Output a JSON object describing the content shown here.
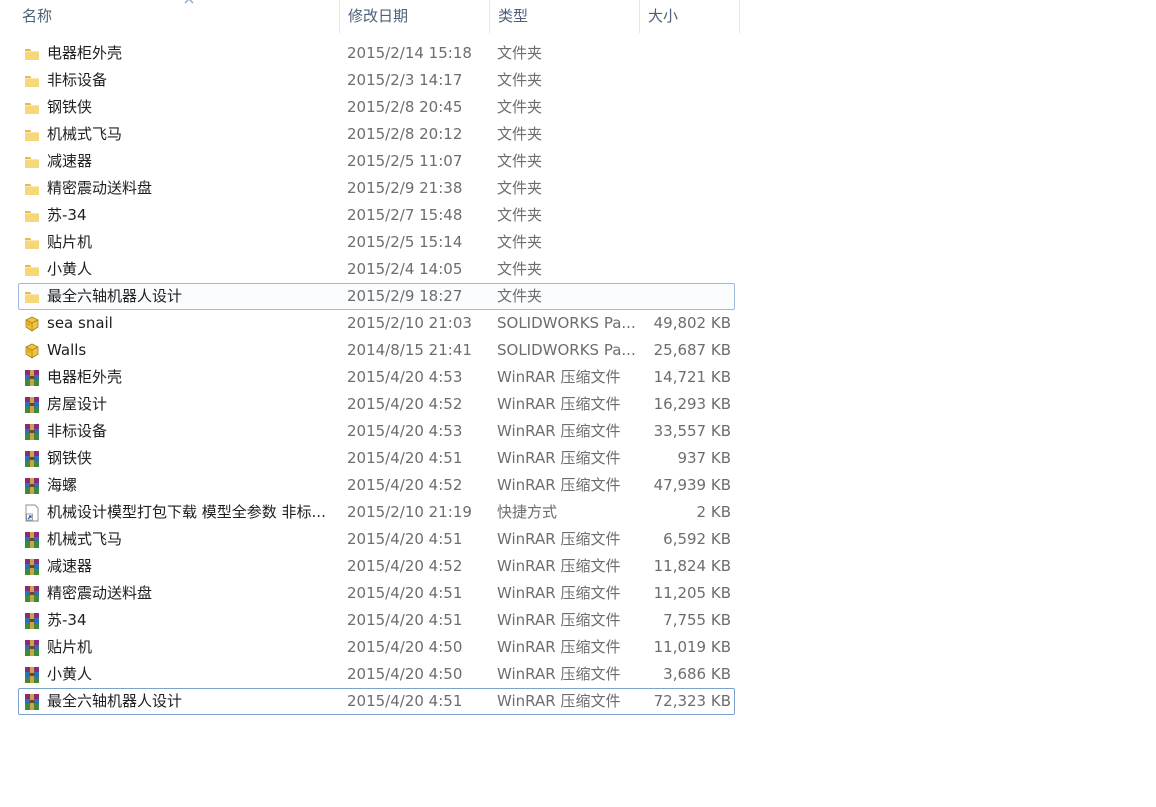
{
  "columns": {
    "name": "名称",
    "date": "修改日期",
    "type": "类型",
    "size": "大小"
  },
  "files": [
    {
      "name": "电器柜外壳",
      "date": "2015/2/14 15:18",
      "type": "文件夹",
      "size": "",
      "icon": "folder-icon"
    },
    {
      "name": "非标设备",
      "date": "2015/2/3 14:17",
      "type": "文件夹",
      "size": "",
      "icon": "folder-icon"
    },
    {
      "name": "钢铁侠",
      "date": "2015/2/8 20:45",
      "type": "文件夹",
      "size": "",
      "icon": "folder-icon"
    },
    {
      "name": "机械式飞马",
      "date": "2015/2/8 20:12",
      "type": "文件夹",
      "size": "",
      "icon": "folder-icon"
    },
    {
      "name": "减速器",
      "date": "2015/2/5 11:07",
      "type": "文件夹",
      "size": "",
      "icon": "folder-icon"
    },
    {
      "name": "精密震动送料盘",
      "date": "2015/2/9 21:38",
      "type": "文件夹",
      "size": "",
      "icon": "folder-icon"
    },
    {
      "name": "苏-34",
      "date": "2015/2/7 15:48",
      "type": "文件夹",
      "size": "",
      "icon": "folder-icon"
    },
    {
      "name": "贴片机",
      "date": "2015/2/5 15:14",
      "type": "文件夹",
      "size": "",
      "icon": "folder-icon"
    },
    {
      "name": "小黄人",
      "date": "2015/2/4 14:05",
      "type": "文件夹",
      "size": "",
      "icon": "folder-icon"
    },
    {
      "name": "最全六轴机器人设计",
      "date": "2015/2/9 18:27",
      "type": "文件夹",
      "size": "",
      "icon": "folder-icon"
    },
    {
      "name": "sea snail",
      "date": "2015/2/10 21:03",
      "type": "SOLIDWORKS Pa...",
      "size": "49,802 KB",
      "icon": "solidworks-icon"
    },
    {
      "name": "Walls",
      "date": "2014/8/15 21:41",
      "type": "SOLIDWORKS Pa...",
      "size": "25,687 KB",
      "icon": "solidworks-icon"
    },
    {
      "name": "电器柜外壳",
      "date": "2015/4/20 4:53",
      "type": "WinRAR 压缩文件",
      "size": "14,721 KB",
      "icon": "winrar-icon"
    },
    {
      "name": "房屋设计",
      "date": "2015/4/20 4:52",
      "type": "WinRAR 压缩文件",
      "size": "16,293 KB",
      "icon": "winrar-icon"
    },
    {
      "name": "非标设备",
      "date": "2015/4/20 4:53",
      "type": "WinRAR 压缩文件",
      "size": "33,557 KB",
      "icon": "winrar-icon"
    },
    {
      "name": "钢铁侠",
      "date": "2015/4/20 4:51",
      "type": "WinRAR 压缩文件",
      "size": "937 KB",
      "icon": "winrar-icon"
    },
    {
      "name": "海螺",
      "date": "2015/4/20 4:52",
      "type": "WinRAR 压缩文件",
      "size": "47,939 KB",
      "icon": "winrar-icon"
    },
    {
      "name": "机械设计模型打包下载 模型全参数 非标...",
      "date": "2015/2/10 21:19",
      "type": "快捷方式",
      "size": "2 KB",
      "icon": "shortcut-icon"
    },
    {
      "name": "机械式飞马",
      "date": "2015/4/20 4:51",
      "type": "WinRAR 压缩文件",
      "size": "6,592 KB",
      "icon": "winrar-icon"
    },
    {
      "name": "减速器",
      "date": "2015/4/20 4:52",
      "type": "WinRAR 压缩文件",
      "size": "11,824 KB",
      "icon": "winrar-icon"
    },
    {
      "name": "精密震动送料盘",
      "date": "2015/4/20 4:51",
      "type": "WinRAR 压缩文件",
      "size": "11,205 KB",
      "icon": "winrar-icon"
    },
    {
      "name": "苏-34",
      "date": "2015/4/20 4:51",
      "type": "WinRAR 压缩文件",
      "size": "7,755 KB",
      "icon": "winrar-icon"
    },
    {
      "name": "贴片机",
      "date": "2015/4/20 4:50",
      "type": "WinRAR 压缩文件",
      "size": "11,019 KB",
      "icon": "winrar-icon"
    },
    {
      "name": "小黄人",
      "date": "2015/4/20 4:50",
      "type": "WinRAR 压缩文件",
      "size": "3,686 KB",
      "icon": "winrar-icon"
    },
    {
      "name": "最全六轴机器人设计",
      "date": "2015/4/20 4:51",
      "type": "WinRAR 压缩文件",
      "size": "72,323 KB",
      "icon": "winrar-icon"
    }
  ],
  "colors": {
    "header_text": "#4c607a",
    "selection_border": "#7da2ce",
    "folder": "#f3cd6a"
  }
}
